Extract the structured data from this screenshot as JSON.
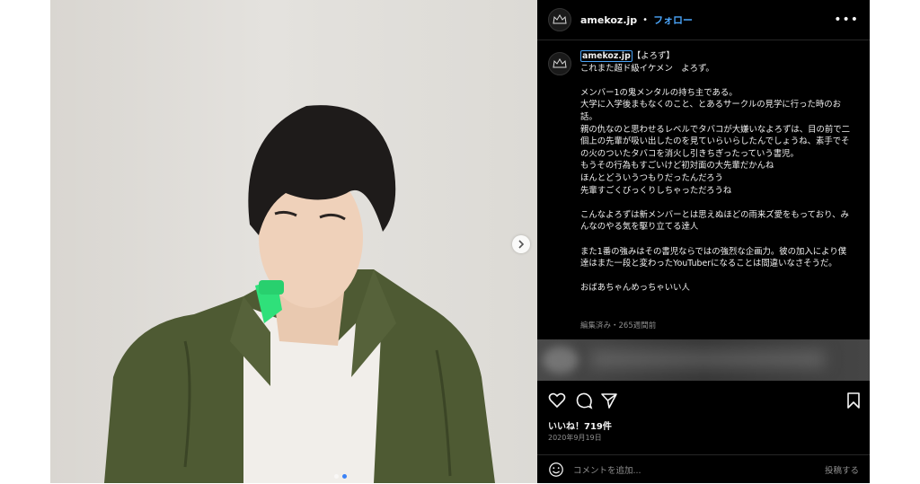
{
  "post": {
    "username": "amekoz.jp",
    "separator": "•",
    "follow_label": "フォロー",
    "more_label": "•••"
  },
  "caption": {
    "username": "amekoz.jp",
    "text": "【よろず】\nこれまた超ド級イケメン　よろず。\n\nメンバー1の鬼メンタルの持ち主である。\n大学に入学後まもなくのこと、とあるサークルの見学に行った時のお話。\n親の仇なのと思わせるレベルでタバコが大嫌いなよろずは、目の前で二個上の先輩が吸い出したのを見ていらいらしたんでしょうね、素手でその火のついたタバコを消火し引きちぎったっていう書児。\nもうその行為もすごいけど初対面の大先輩だかんね\nほんとどういうつもりだったんだろう\n先輩すごくびっくりしちゃっただろうね\n\nこんなよろずは新メンバーとは思えぬほどの雨来ズ愛をもっており、みんなのやる気を駆り立てる達人\n\nまた1番の強みはその書児ならではの強烈な企画力。彼の加入により僕達はまた一段と変わったYouTuberになることは間違いなさそうだ。\n\nおばあちゃんめっちゃいい人",
    "meta": "編集済み・265週間前"
  },
  "likes_text": "いいね！719件",
  "date_text": "2020年9月19日",
  "comment": {
    "placeholder": "コメントを追加...",
    "post_label": "投稿する"
  },
  "carousel": {
    "current_index": 1,
    "total": 2
  },
  "colors": {
    "accent": "#4aa3f7",
    "panel_bg": "#000000",
    "muted": "#8e8e8e",
    "whistle": "#2fe07a"
  },
  "icons": [
    "avatar-crown-icon",
    "more-icon",
    "heart-icon",
    "comment-icon",
    "share-icon",
    "bookmark-icon",
    "emoji-icon",
    "chevron-right-icon"
  ]
}
